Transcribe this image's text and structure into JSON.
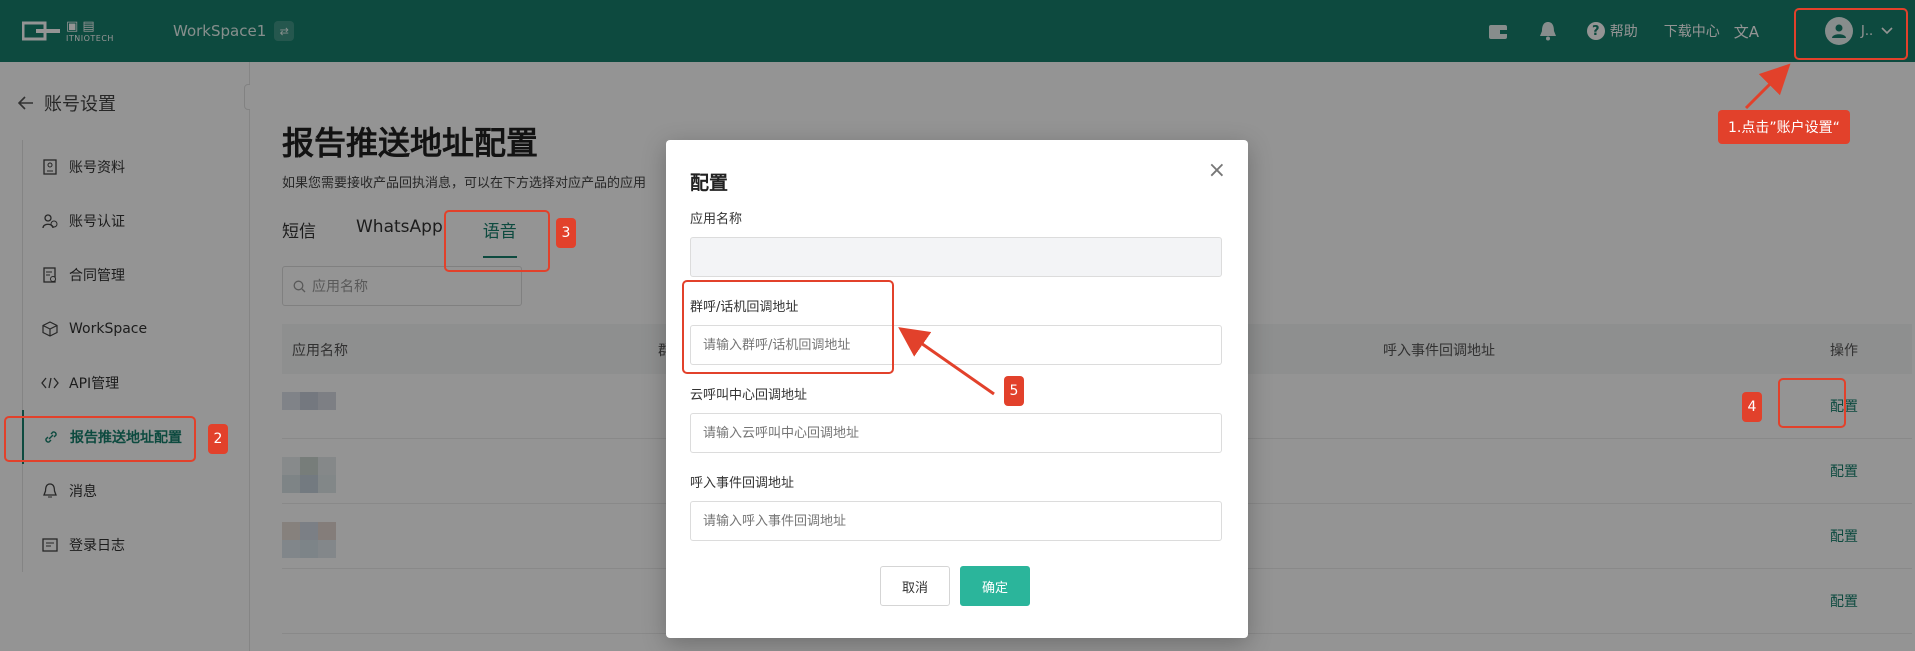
{
  "topbar": {
    "logo_sub": "ITNIOTECH",
    "workspace": "WorkSpace1",
    "workspace_toggle": "⇄",
    "help": "帮助",
    "download": "下载中心",
    "translate": "文A",
    "user_initial": "J..",
    "brand_color": "#18806d"
  },
  "sidebar": {
    "back": "账号设置",
    "items": [
      {
        "label": "账号资料",
        "icon": "id-card-icon"
      },
      {
        "label": "账号认证",
        "icon": "user-check-icon"
      },
      {
        "label": "合同管理",
        "icon": "contract-icon"
      },
      {
        "label": "WorkSpace",
        "icon": "cube-icon"
      },
      {
        "label": "API管理",
        "icon": "code-icon"
      },
      {
        "label": "报告推送地址配置",
        "icon": "link-icon"
      },
      {
        "label": "消息",
        "icon": "bell-icon"
      },
      {
        "label": "登录日志",
        "icon": "log-icon"
      }
    ]
  },
  "main": {
    "title": "报告推送地址配置",
    "desc": "如果您需要接收产品回执消息，可以在下方选择对应产品的应用",
    "tabs": [
      "短信",
      "WhatsApp",
      "语音"
    ],
    "filter_placeholder": "应用名称",
    "columns": [
      "应用名称",
      "群",
      "呼入事件回调地址",
      "操作"
    ],
    "row_action": "配置"
  },
  "modal": {
    "title": "配置",
    "close": "×",
    "app_name_label": "应用名称",
    "app_name_value": "",
    "group_call_label": "群呼/话机回调地址",
    "group_call_placeholder": "请输入群呼/话机回调地址",
    "cloud_call_label": "云呼叫中心回调地址",
    "cloud_call_placeholder": "请输入云呼叫中心回调地址",
    "inbound_label": "呼入事件回调地址",
    "inbound_placeholder": "请输入呼入事件回调地址",
    "cancel": "取消",
    "ok": "确定"
  },
  "annotations": {
    "note1": "1.点击”账户设置“",
    "n2": "2",
    "n3": "3",
    "n4": "4",
    "n5": "5",
    "color": "#e2412b"
  }
}
